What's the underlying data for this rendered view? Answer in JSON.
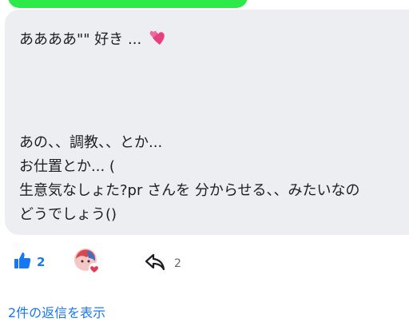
{
  "comment": {
    "lines": [
      "ああああ\"\" 好き ...",
      "あの、、調教、、とか...",
      "お仕置とか... (",
      "生意気なしょた?pr さんを 分からせる、、みたいなの",
      "どうでしょう()"
    ],
    "emoji": "two-hearts-icon"
  },
  "actions": {
    "like_count": "2",
    "share_count": "2"
  },
  "replies": {
    "link_label": "2件の返信を表示"
  },
  "colors": {
    "accent": "#1877f2",
    "bubble": "#eceef1",
    "highlight": "#2ee94a"
  }
}
